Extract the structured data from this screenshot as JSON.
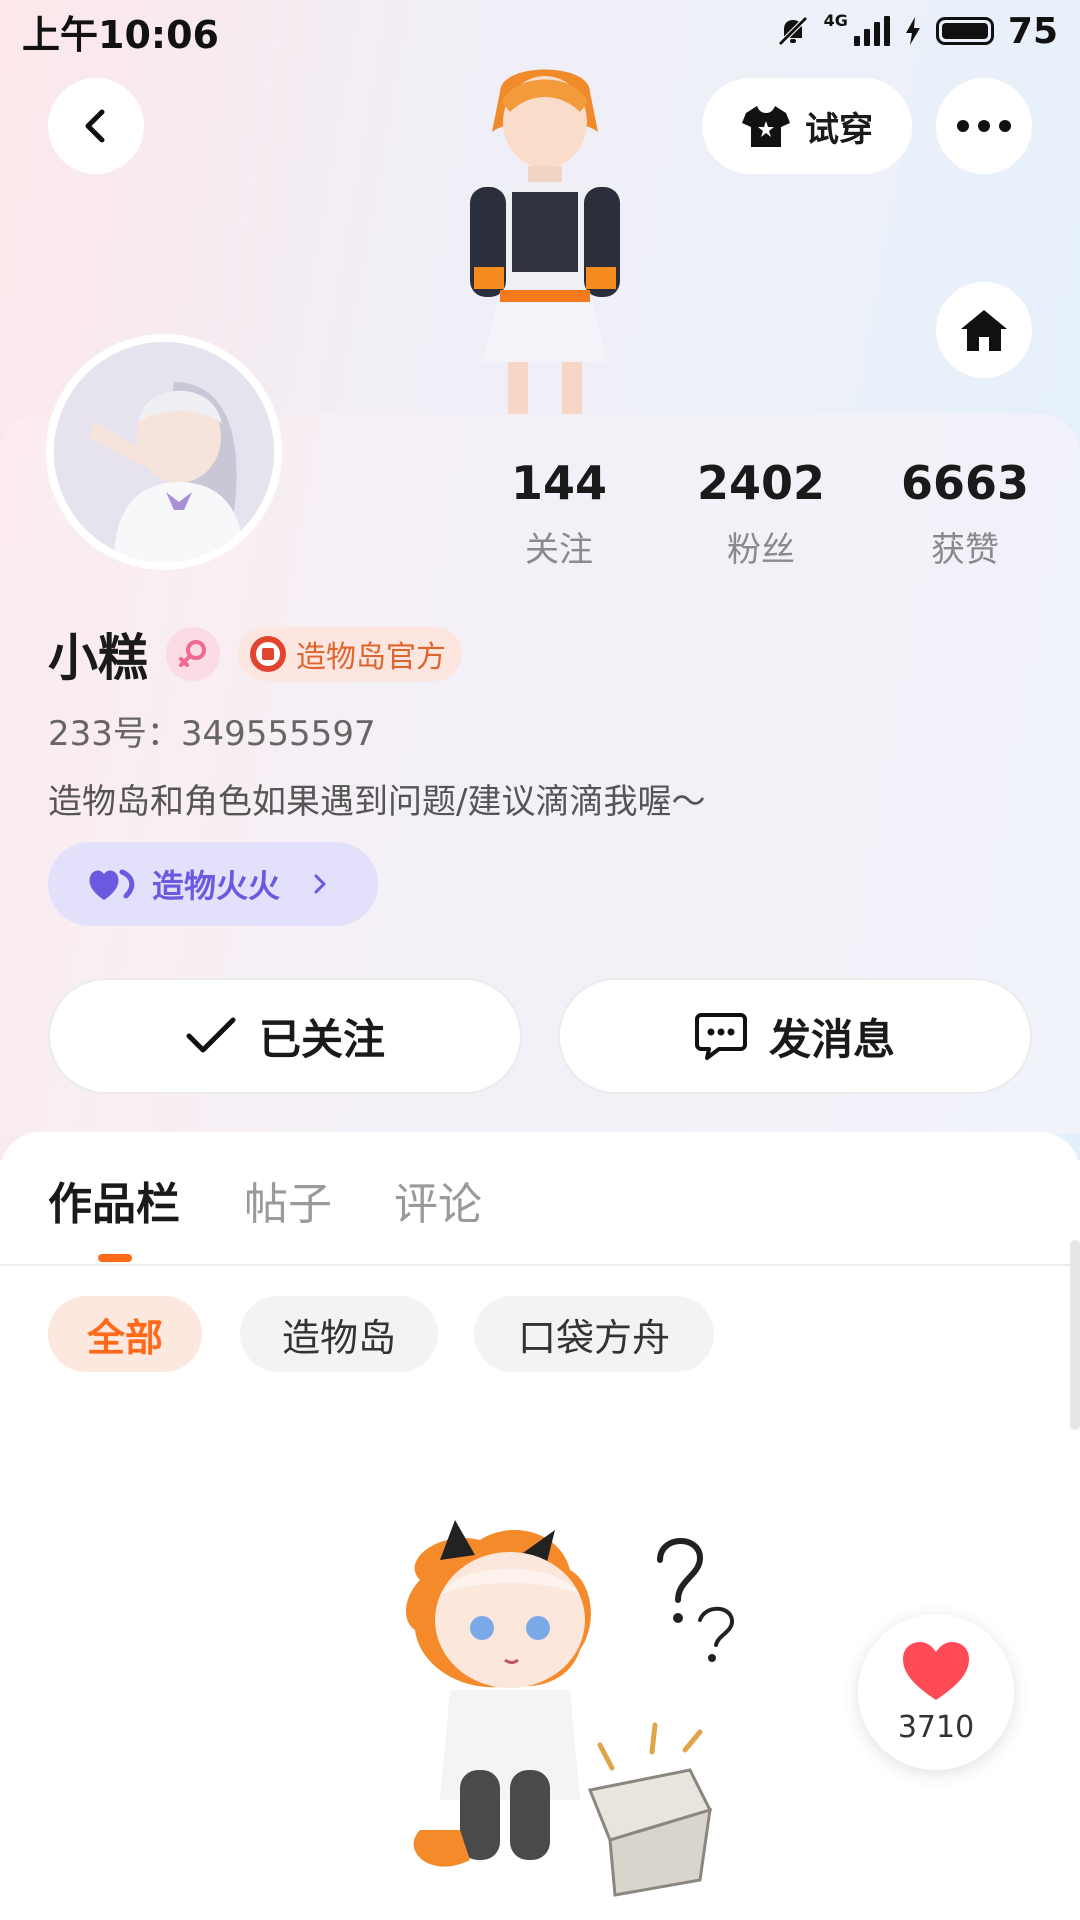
{
  "status_bar": {
    "time": "上午10:06",
    "network": "4G",
    "battery": "75"
  },
  "top_actions": {
    "back_icon": "chevron-left-icon",
    "try_on_label": "试穿",
    "more_icon": "more-horizontal-icon",
    "home_icon": "home-icon"
  },
  "profile": {
    "name": "小糕",
    "official_badge": "造物岛官方",
    "uid": "233号：349555597",
    "bio": "造物岛和角色如果遇到问题/建议滴滴我喔～",
    "fire_chip_label": "造物火火",
    "stats": [
      {
        "value": "144",
        "label": "关注"
      },
      {
        "value": "2402",
        "label": "粉丝"
      },
      {
        "value": "6663",
        "label": "获赞"
      }
    ]
  },
  "actions": {
    "follow_label": "已关注",
    "message_label": "发消息"
  },
  "tabs": [
    {
      "label": "作品栏",
      "active": true
    },
    {
      "label": "帖子",
      "active": false
    },
    {
      "label": "评论",
      "active": false
    }
  ],
  "filters": [
    {
      "label": "全部",
      "active": true
    },
    {
      "label": "造物岛",
      "active": false
    },
    {
      "label": "口袋方舟",
      "active": false
    }
  ],
  "like_float": {
    "count": "3710"
  },
  "colors": {
    "accent": "#ff6a1a",
    "fire_purple": "#6a5ae0",
    "heart_red": "#ff4b55"
  }
}
